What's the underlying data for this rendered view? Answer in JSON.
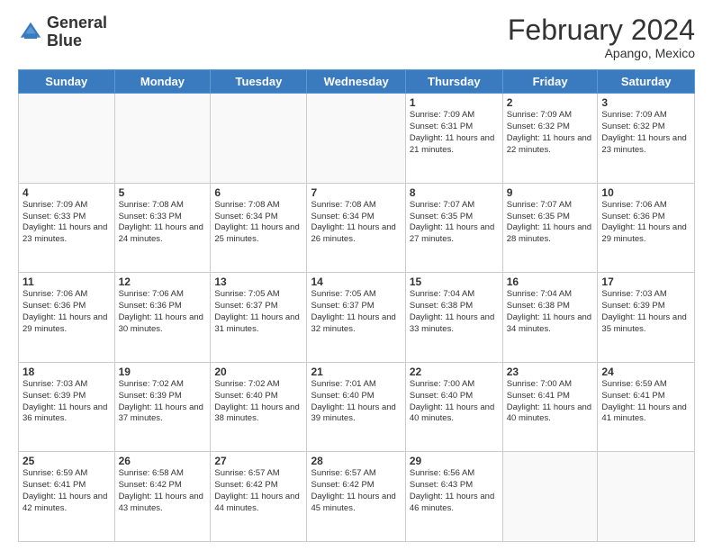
{
  "header": {
    "logo_line1": "General",
    "logo_line2": "Blue",
    "month": "February 2024",
    "location": "Apango, Mexico"
  },
  "days_of_week": [
    "Sunday",
    "Monday",
    "Tuesday",
    "Wednesday",
    "Thursday",
    "Friday",
    "Saturday"
  ],
  "weeks": [
    [
      {
        "day": "",
        "info": ""
      },
      {
        "day": "",
        "info": ""
      },
      {
        "day": "",
        "info": ""
      },
      {
        "day": "",
        "info": ""
      },
      {
        "day": "1",
        "info": "Sunrise: 7:09 AM\nSunset: 6:31 PM\nDaylight: 11 hours and 21 minutes."
      },
      {
        "day": "2",
        "info": "Sunrise: 7:09 AM\nSunset: 6:32 PM\nDaylight: 11 hours and 22 minutes."
      },
      {
        "day": "3",
        "info": "Sunrise: 7:09 AM\nSunset: 6:32 PM\nDaylight: 11 hours and 23 minutes."
      }
    ],
    [
      {
        "day": "4",
        "info": "Sunrise: 7:09 AM\nSunset: 6:33 PM\nDaylight: 11 hours and 23 minutes."
      },
      {
        "day": "5",
        "info": "Sunrise: 7:08 AM\nSunset: 6:33 PM\nDaylight: 11 hours and 24 minutes."
      },
      {
        "day": "6",
        "info": "Sunrise: 7:08 AM\nSunset: 6:34 PM\nDaylight: 11 hours and 25 minutes."
      },
      {
        "day": "7",
        "info": "Sunrise: 7:08 AM\nSunset: 6:34 PM\nDaylight: 11 hours and 26 minutes."
      },
      {
        "day": "8",
        "info": "Sunrise: 7:07 AM\nSunset: 6:35 PM\nDaylight: 11 hours and 27 minutes."
      },
      {
        "day": "9",
        "info": "Sunrise: 7:07 AM\nSunset: 6:35 PM\nDaylight: 11 hours and 28 minutes."
      },
      {
        "day": "10",
        "info": "Sunrise: 7:06 AM\nSunset: 6:36 PM\nDaylight: 11 hours and 29 minutes."
      }
    ],
    [
      {
        "day": "11",
        "info": "Sunrise: 7:06 AM\nSunset: 6:36 PM\nDaylight: 11 hours and 29 minutes."
      },
      {
        "day": "12",
        "info": "Sunrise: 7:06 AM\nSunset: 6:36 PM\nDaylight: 11 hours and 30 minutes."
      },
      {
        "day": "13",
        "info": "Sunrise: 7:05 AM\nSunset: 6:37 PM\nDaylight: 11 hours and 31 minutes."
      },
      {
        "day": "14",
        "info": "Sunrise: 7:05 AM\nSunset: 6:37 PM\nDaylight: 11 hours and 32 minutes."
      },
      {
        "day": "15",
        "info": "Sunrise: 7:04 AM\nSunset: 6:38 PM\nDaylight: 11 hours and 33 minutes."
      },
      {
        "day": "16",
        "info": "Sunrise: 7:04 AM\nSunset: 6:38 PM\nDaylight: 11 hours and 34 minutes."
      },
      {
        "day": "17",
        "info": "Sunrise: 7:03 AM\nSunset: 6:39 PM\nDaylight: 11 hours and 35 minutes."
      }
    ],
    [
      {
        "day": "18",
        "info": "Sunrise: 7:03 AM\nSunset: 6:39 PM\nDaylight: 11 hours and 36 minutes."
      },
      {
        "day": "19",
        "info": "Sunrise: 7:02 AM\nSunset: 6:39 PM\nDaylight: 11 hours and 37 minutes."
      },
      {
        "day": "20",
        "info": "Sunrise: 7:02 AM\nSunset: 6:40 PM\nDaylight: 11 hours and 38 minutes."
      },
      {
        "day": "21",
        "info": "Sunrise: 7:01 AM\nSunset: 6:40 PM\nDaylight: 11 hours and 39 minutes."
      },
      {
        "day": "22",
        "info": "Sunrise: 7:00 AM\nSunset: 6:40 PM\nDaylight: 11 hours and 40 minutes."
      },
      {
        "day": "23",
        "info": "Sunrise: 7:00 AM\nSunset: 6:41 PM\nDaylight: 11 hours and 40 minutes."
      },
      {
        "day": "24",
        "info": "Sunrise: 6:59 AM\nSunset: 6:41 PM\nDaylight: 11 hours and 41 minutes."
      }
    ],
    [
      {
        "day": "25",
        "info": "Sunrise: 6:59 AM\nSunset: 6:41 PM\nDaylight: 11 hours and 42 minutes."
      },
      {
        "day": "26",
        "info": "Sunrise: 6:58 AM\nSunset: 6:42 PM\nDaylight: 11 hours and 43 minutes."
      },
      {
        "day": "27",
        "info": "Sunrise: 6:57 AM\nSunset: 6:42 PM\nDaylight: 11 hours and 44 minutes."
      },
      {
        "day": "28",
        "info": "Sunrise: 6:57 AM\nSunset: 6:42 PM\nDaylight: 11 hours and 45 minutes."
      },
      {
        "day": "29",
        "info": "Sunrise: 6:56 AM\nSunset: 6:43 PM\nDaylight: 11 hours and 46 minutes."
      },
      {
        "day": "",
        "info": ""
      },
      {
        "day": "",
        "info": ""
      }
    ]
  ]
}
